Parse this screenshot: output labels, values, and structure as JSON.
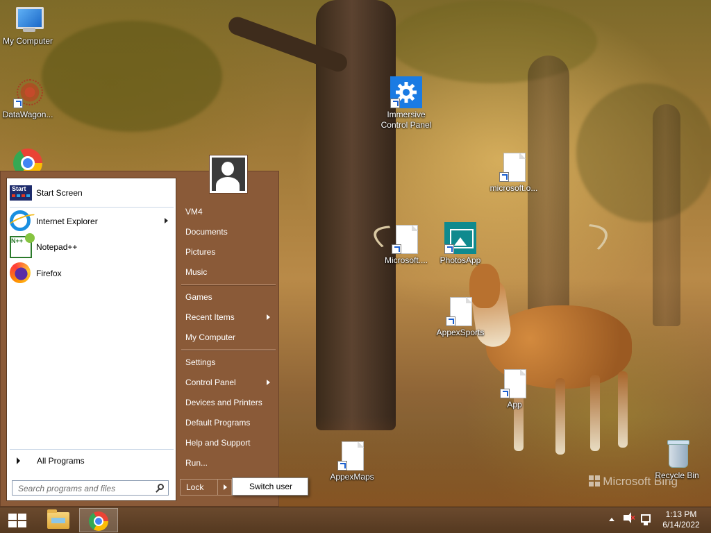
{
  "desktop": {
    "icons": [
      {
        "label": "My Computer"
      },
      {
        "label": "DataWagon..."
      },
      {
        "label": ""
      },
      {
        "label": "Immersive Control Panel"
      },
      {
        "label": "microsoft.o..."
      },
      {
        "label": "Microsoft...."
      },
      {
        "label": "PhotosApp"
      },
      {
        "label": "AppexSports"
      },
      {
        "label": "App"
      },
      {
        "label": "AppexMaps"
      },
      {
        "label": "Recycle Bin"
      }
    ],
    "watermark": "Microsoft Bing"
  },
  "start_menu": {
    "pinned": [
      {
        "label": "Start Screen",
        "icon": "start-screen-icon",
        "icon_text": "Start"
      },
      {
        "label": "Internet Explorer",
        "icon": "internet-explorer-icon"
      },
      {
        "label": "Notepad++",
        "icon": "notepad-plus-plus-icon",
        "icon_text": "N++"
      },
      {
        "label": "Firefox",
        "icon": "firefox-icon"
      }
    ],
    "all_programs": "All Programs",
    "search_placeholder": "Search programs and files",
    "right_items": [
      {
        "label": "VM4"
      },
      {
        "label": "Documents"
      },
      {
        "label": "Pictures"
      },
      {
        "label": "Music"
      },
      {
        "label": "Games"
      },
      {
        "label": "Recent Items"
      },
      {
        "label": "My Computer"
      },
      {
        "label": "Settings"
      },
      {
        "label": "Control Panel"
      },
      {
        "label": "Devices and Printers"
      },
      {
        "label": "Default Programs"
      },
      {
        "label": "Help and Support"
      },
      {
        "label": "Run..."
      }
    ],
    "lock_label": "Lock",
    "switch_user_label": "Switch user"
  },
  "taskbar": {
    "apps": [
      "file-explorer",
      "chrome"
    ],
    "active_app": "chrome"
  },
  "tray": {
    "time": "1:13 PM",
    "date": "6/14/2022"
  },
  "colors": {
    "start_menu_bg": "#8a5a38",
    "taskbar_bg": "#5f412a",
    "accent_blue": "#1a7be3"
  }
}
